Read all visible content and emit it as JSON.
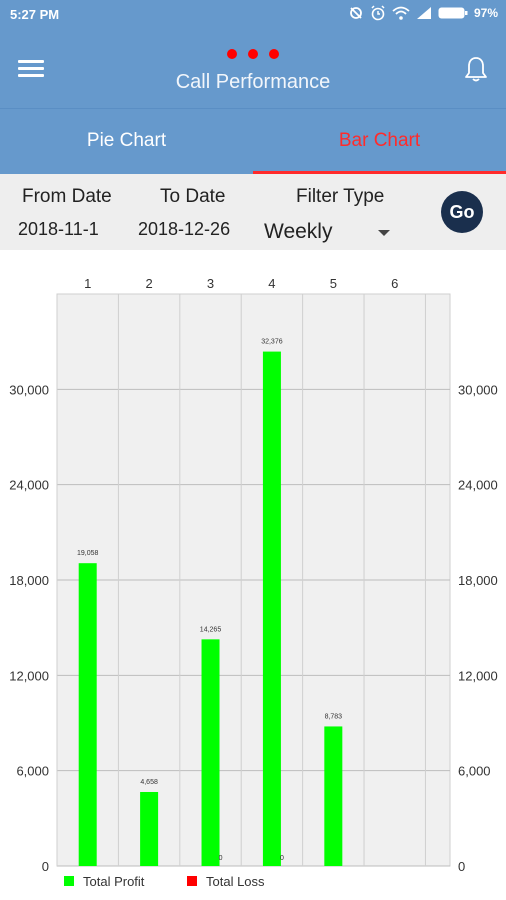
{
  "status_bar": {
    "time": "5:27 PM",
    "battery": "97%",
    "icons": [
      "sync-icon",
      "alarm-icon",
      "wifi-icon",
      "signal-icon",
      "battery-icon"
    ]
  },
  "app_bar": {
    "title": "Call Performance",
    "menu_icon": "hamburger-menu-icon",
    "notification_icon": "bell-icon",
    "dots_color": "#ff0000"
  },
  "tabs": [
    {
      "label": "Pie Chart",
      "active": false
    },
    {
      "label": "Bar Chart",
      "active": true
    }
  ],
  "filters": {
    "from_label": "From Date",
    "from_value": "2018-11-1",
    "to_label": "To Date",
    "to_value": "2018-12-26",
    "type_label": "Filter Type",
    "type_value": "Weekly",
    "go_label": "Go"
  },
  "colors": {
    "primary": "#6699cc",
    "accent": "#ff2b2b",
    "go_button": "#1a2f4d",
    "profit": "#00ff00",
    "loss": "#ff0000"
  },
  "chart_data": {
    "type": "bar",
    "categories": [
      "1",
      "2",
      "3",
      "4",
      "5",
      "6"
    ],
    "series": [
      {
        "name": "Total Profit",
        "color": "#00ff00",
        "values": [
          19058,
          4658,
          14265,
          32376,
          8783,
          null
        ]
      },
      {
        "name": "Total Loss",
        "color": "#ff0000",
        "values": [
          null,
          null,
          0,
          0,
          null,
          null
        ]
      }
    ],
    "value_labels": [
      "19,058",
      "4,658",
      "14,265",
      "32,376",
      "8,783"
    ],
    "loss_labels": [
      "0",
      "0"
    ],
    "yticks": [
      "0",
      "6,000",
      "12,000",
      "18,000",
      "24,000",
      "30,000"
    ],
    "ylim": [
      0,
      36000
    ],
    "grid": true,
    "legend_position": "bottom-left"
  }
}
